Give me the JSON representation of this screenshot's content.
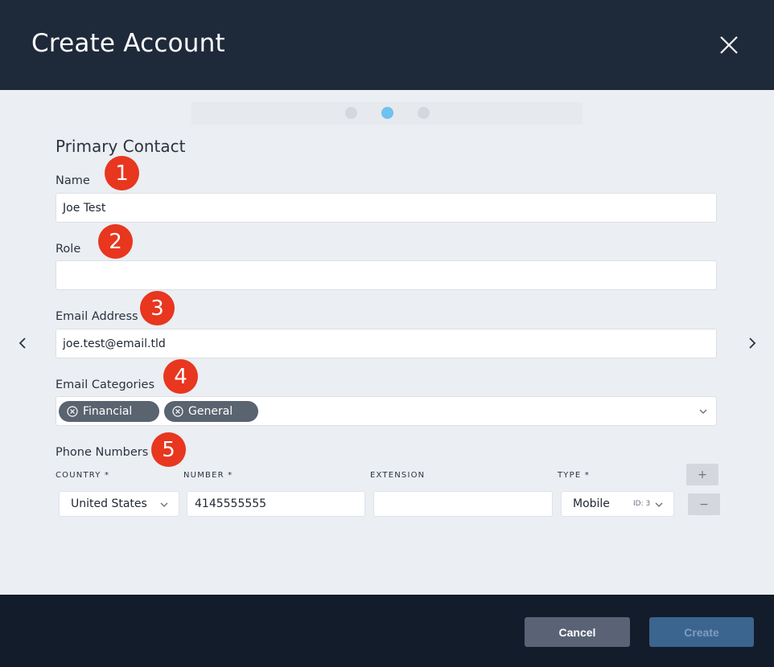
{
  "header": {
    "title": "Create Account"
  },
  "steps": {
    "count": 3,
    "active": 2
  },
  "section": {
    "title": "Primary Contact"
  },
  "badges": [
    "1",
    "2",
    "3",
    "4",
    "5"
  ],
  "fields": {
    "name": {
      "label": "Name",
      "value": "Joe Test"
    },
    "role": {
      "label": "Role",
      "value": ""
    },
    "email": {
      "label": "Email Address",
      "value": "joe.test@email.tld"
    },
    "email_categories": {
      "label": "Email Categories",
      "chips": [
        "Financial",
        "General"
      ]
    }
  },
  "phone": {
    "label": "Phone Numbers",
    "columns": {
      "country": "COUNTRY *",
      "number": "NUMBER *",
      "extension": "EXTENSION",
      "type": "TYPE *"
    },
    "rows": [
      {
        "country": "United States",
        "number": "4145555555",
        "extension": "",
        "type": "Mobile",
        "type_id": "ID: 3"
      }
    ],
    "add_label": "+",
    "remove_label": "−"
  },
  "footer": {
    "cancel_label": "Cancel",
    "create_label": "Create"
  },
  "colors": {
    "header_bg": "#1e2a3a",
    "footer_bg": "#121c2b",
    "badge": "#e8361f",
    "active_dot": "#70c0f0",
    "chip_bg": "#5a6370"
  }
}
